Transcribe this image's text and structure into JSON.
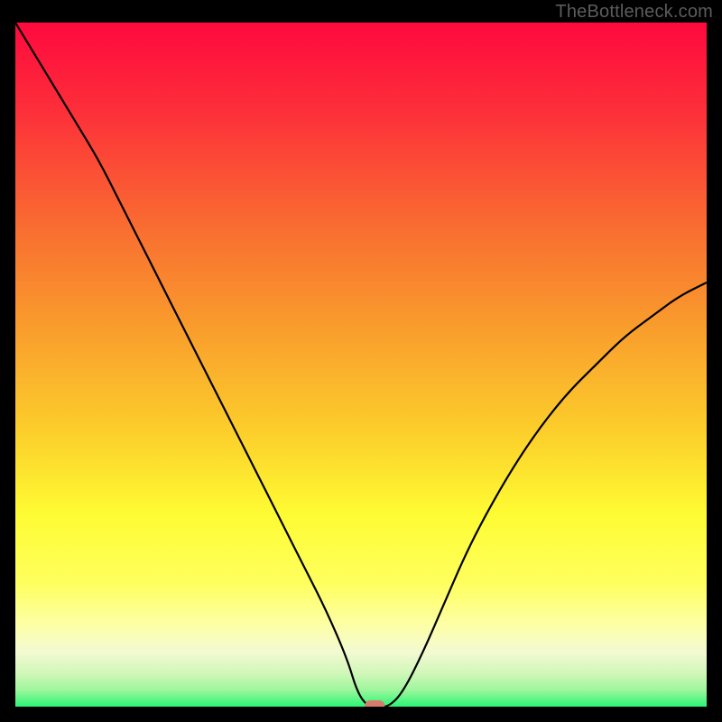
{
  "watermark": "TheBottleneck.com",
  "colors": {
    "gradient_top": "#fe093e",
    "gradient_mid1": "#f7902c",
    "gradient_mid2": "#fefd33",
    "gradient_bottom_band": "#f6fbc8",
    "gradient_bottom": "#2af574",
    "curve": "#000000",
    "marker": "#d77b6e",
    "frame": "#000000"
  },
  "chart_data": {
    "type": "line",
    "title": "",
    "xlabel": "",
    "ylabel": "",
    "xlim": [
      0,
      100
    ],
    "ylim": [
      0,
      100
    ],
    "x": [
      0,
      3,
      6,
      9,
      12,
      15,
      18,
      21,
      24,
      27,
      30,
      33,
      36,
      39,
      42,
      45,
      48,
      49.5,
      51,
      52.5,
      54,
      56,
      59,
      62,
      65,
      68,
      72,
      76,
      80,
      84,
      88,
      92,
      96,
      100
    ],
    "values": [
      100,
      95,
      90,
      85,
      80,
      74,
      68,
      62,
      56,
      50,
      44,
      38,
      32,
      26,
      20,
      14,
      7,
      2,
      0,
      0,
      0,
      2,
      8,
      15,
      22,
      28,
      35,
      41,
      46,
      50,
      54,
      57,
      60,
      62
    ],
    "marker": {
      "x": 52,
      "y": 0
    },
    "grid": false,
    "legend": false
  }
}
